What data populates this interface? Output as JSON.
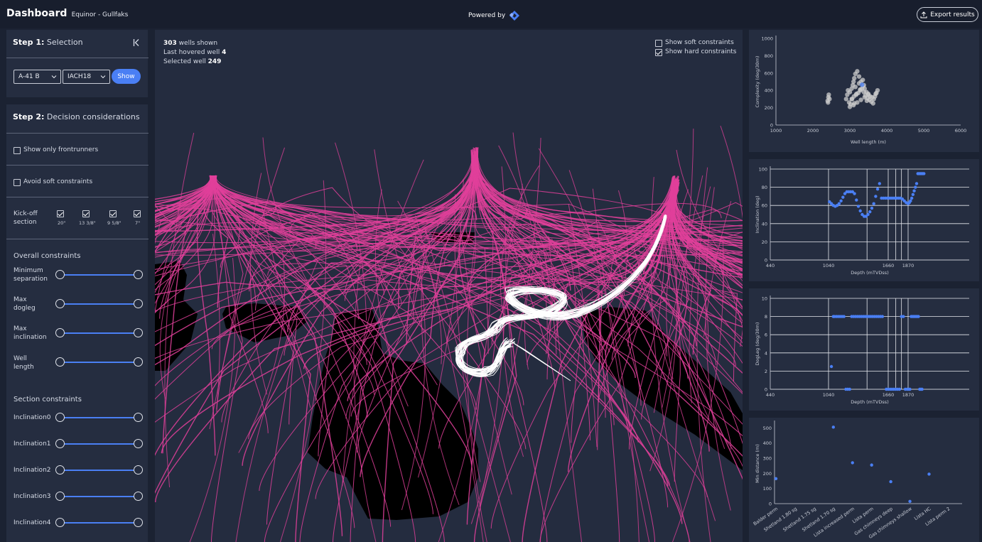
{
  "header": {
    "title": "Dashboard",
    "subtitle": "Equinor - Gullfaks",
    "powered_by": "Powered by",
    "export_label": "Export results"
  },
  "step1": {
    "label_bold": "Step 1:",
    "label": "Selection",
    "select1": "A-41 B",
    "select2": "IACH18",
    "show_label": "Show"
  },
  "step2": {
    "label_bold": "Step 2:",
    "label": "Decision considerations",
    "frontrunners": "Show only frontrunners",
    "avoid_soft": "Avoid soft constraints",
    "kickoff": "Kick-off\nsection",
    "kickoff_items": [
      "20\"",
      "13 3/8\"",
      "9 5/8\"",
      "7\""
    ],
    "overall_title": "Overall constraints",
    "overall": [
      "Minimum separation",
      "Max dogleg",
      "Max inclination",
      "Well length"
    ],
    "section_title": "Section constraints",
    "sections": [
      "Inclination0",
      "Inclination1",
      "Inclination2",
      "Inclination3",
      "Inclination4"
    ]
  },
  "view": {
    "wells_count": "303",
    "wells_text": "wells shown",
    "hovered_text": "Last hovered well",
    "hovered_value": "4",
    "selected_text": "Selected well",
    "selected_value": "249",
    "soft_label": "Show soft constraints",
    "hard_label": "Show hard constraints"
  },
  "colors": {
    "accent": "#4a7ff4",
    "well_pink": "#e0409a",
    "well_selected": "#ffffff",
    "panel": "#252d40",
    "background": "#1b2232"
  },
  "chart_data": [
    {
      "type": "scatter",
      "xlabel": "Well length (m)",
      "ylabel": "Complexity (deg/30m)",
      "xticks": [
        1000,
        2000,
        3000,
        4000,
        5000,
        6000
      ],
      "yticks": [
        0,
        200,
        400,
        600,
        800,
        1000
      ],
      "xlim": [
        1000,
        6000
      ],
      "ylim": [
        0,
        1000
      ],
      "grid": false,
      "series": [
        {
          "color": "#cccccc",
          "x": [
            2400,
            2420,
            2450,
            2430,
            2410,
            2900,
            2930,
            2950,
            3000,
            3050,
            3080,
            3100,
            3120,
            3150,
            3200,
            3250,
            3300,
            3350,
            3400,
            3450,
            3500,
            3550,
            3600,
            3650,
            3700,
            3750,
            2980,
            3020,
            3060,
            3110,
            3170,
            3230,
            3280,
            3330,
            3380,
            3420,
            3480,
            3530,
            3580,
            3630,
            3680,
            3720,
            3000,
            3100,
            3200,
            3300,
            3400,
            3500,
            3150,
            3250,
            3350,
            3050,
            3180,
            3280,
            3120,
            3380,
            3460
          ],
          "y": [
            280,
            320,
            300,
            350,
            260,
            300,
            350,
            400,
            380,
            420,
            460,
            500,
            540,
            590,
            620,
            560,
            500,
            450,
            420,
            380,
            360,
            330,
            320,
            300,
            360,
            400,
            260,
            240,
            300,
            330,
            350,
            370,
            400,
            420,
            380,
            340,
            310,
            290,
            270,
            250,
            330,
            370,
            210,
            230,
            260,
            290,
            320,
            350,
            440,
            480,
            520,
            300,
            360,
            410,
            250,
            460,
            280
          ]
        },
        {
          "color": "#4a7ff4",
          "x": [
            3330
          ],
          "y": [
            465
          ]
        }
      ]
    },
    {
      "type": "scatter",
      "xlabel": "Depth (mTVDss)",
      "ylabel": "Inclination (deg)",
      "xticks": [
        440,
        1040,
        1660,
        1870
      ],
      "yticks": [
        0,
        20,
        40,
        60,
        80,
        100
      ],
      "ylim": [
        0,
        100
      ],
      "grid": true,
      "series": [
        {
          "color": "#4a7ff4",
          "x": [
            1050,
            1070,
            1090,
            1110,
            1130,
            1150,
            1170,
            1190,
            1210,
            1230,
            1250,
            1270,
            1290,
            1310,
            1330,
            1350,
            1370,
            1390,
            1410,
            1430,
            1450,
            1470,
            1490,
            1510,
            1530,
            1550,
            1570,
            1590,
            1610,
            1630,
            1650,
            1670,
            1690,
            1710,
            1730,
            1750,
            1770,
            1790,
            1810,
            1830,
            1850,
            1870,
            1890,
            1910,
            1930,
            1950,
            1970,
            1990,
            2010,
            2030,
            2050,
            2070,
            2090,
            2110,
            2130
          ],
          "y": [
            64,
            62,
            60,
            59,
            60,
            62,
            65,
            69,
            73,
            75,
            75,
            75,
            75,
            73,
            66,
            59,
            54,
            50,
            48,
            48,
            50,
            53,
            57,
            62,
            70,
            78,
            84,
            68,
            68,
            68,
            68,
            68,
            68,
            68,
            68,
            68,
            68,
            68,
            67,
            65,
            63,
            62,
            63,
            65,
            68,
            72,
            76,
            80,
            84,
            95,
            95,
            95,
            95,
            95,
            95
          ]
        }
      ]
    },
    {
      "type": "scatter",
      "xlabel": "Depth (mTVDss)",
      "ylabel": "DogLeg (deg/30m)",
      "xticks": [
        440,
        1040,
        1660,
        1870
      ],
      "yticks": [
        0,
        2,
        4,
        6,
        8,
        10
      ],
      "ylim": [
        0,
        10
      ],
      "grid": true,
      "series": [
        {
          "color": "#4a7ff4",
          "x": [
            1070,
            1090,
            1100,
            1120,
            1140,
            1160,
            1180,
            1200,
            1220,
            1240,
            1260,
            1280,
            1300,
            1320,
            1340,
            1360,
            1380,
            1400,
            1420,
            1440,
            1460,
            1480,
            1500,
            1520,
            1540,
            1560,
            1580,
            1600,
            1640,
            1660,
            1680,
            1700,
            1720,
            1740,
            1760,
            1780,
            1800,
            1820,
            1840,
            1860,
            1880,
            1900,
            1920,
            1940,
            1960,
            1980,
            2000,
            2020,
            2040,
            2060,
            2080,
            2100
          ],
          "y": [
            2.5,
            8,
            8,
            8,
            8,
            8,
            8,
            8,
            0,
            0,
            0,
            8,
            8,
            8,
            8,
            8,
            8,
            8,
            8,
            8,
            8,
            8,
            8,
            8,
            8,
            8,
            8,
            8,
            0,
            0,
            0,
            0,
            0,
            0,
            0,
            0,
            8,
            8,
            0,
            0,
            0,
            0,
            8,
            8,
            8,
            8,
            8,
            8,
            8,
            0,
            0,
            0
          ]
        }
      ]
    },
    {
      "type": "scatter",
      "xlabel": "",
      "ylabel": "Min distance (m)",
      "categories": [
        "Balder perm",
        "Shetland 1.80 sg",
        "Shetland 1.75 sg",
        "Shetland 1.70 sg",
        "Lista increased perm",
        "Lista perm",
        "Gas chimneys deep",
        "Gas chimneys shallow",
        "Lista HC",
        "Lista perm 2"
      ],
      "yticks": [
        0,
        100,
        200,
        300,
        400,
        500
      ],
      "ylim": [
        0,
        530
      ],
      "grid": false,
      "series": [
        {
          "color": "#4a7ff4",
          "x": [
            0,
            3,
            4,
            5,
            6,
            7,
            8
          ],
          "y": [
            165,
            505,
            270,
            255,
            145,
            15,
            195
          ]
        }
      ]
    }
  ]
}
